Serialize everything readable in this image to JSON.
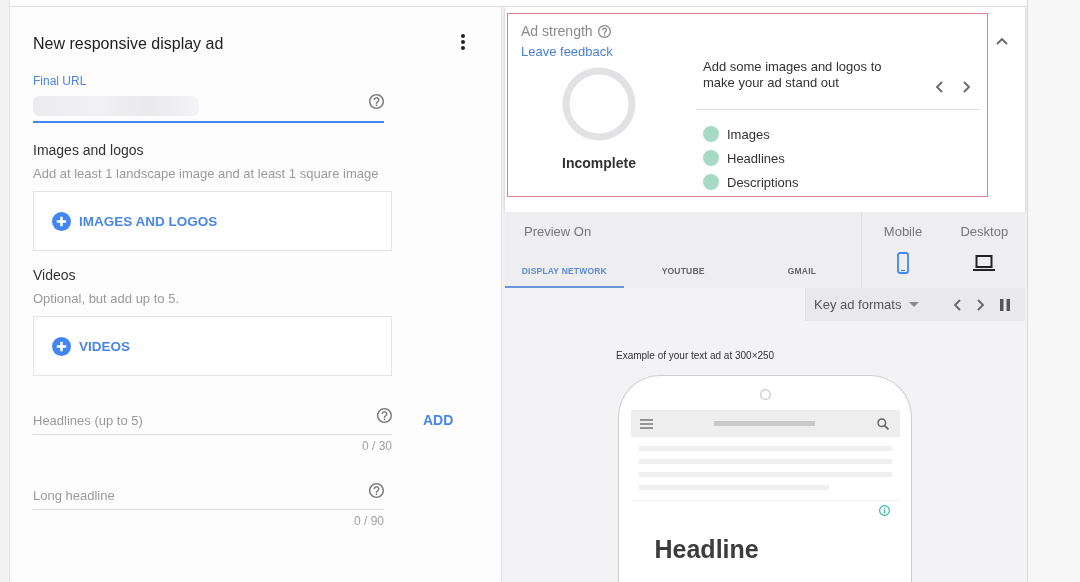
{
  "editor": {
    "title": "New responsive display ad",
    "final_url": {
      "label": "Final URL",
      "focused": true,
      "redacted": true
    },
    "sections": [
      {
        "kind": "upload",
        "title": "Images and logos",
        "hint": "Add at least 1 landscape image and at least 1 square image",
        "button": "IMAGES AND LOGOS"
      },
      {
        "kind": "upload",
        "title": "Videos",
        "hint": "Optional, but add up to 5.",
        "button": "VIDEOS"
      },
      {
        "kind": "text",
        "placeholder": "Headlines (up to 5)",
        "counter": "0 / 30",
        "add_button": "ADD"
      },
      {
        "kind": "text",
        "placeholder": "Long headline",
        "counter": "0 / 90"
      }
    ]
  },
  "ad_strength": {
    "title": "Ad strength",
    "link": "Leave feedback",
    "rating": "Incomplete",
    "tip": "Add some images and logos to make your ad stand out",
    "checklist": [
      "Images",
      "Headlines",
      "Descriptions"
    ]
  },
  "preview": {
    "title": "Preview On",
    "tabs": [
      {
        "label": "DISPLAY NETWORK",
        "selected": true
      },
      {
        "label": "YOUTUBE",
        "selected": false
      },
      {
        "label": "GMAIL",
        "selected": false
      }
    ],
    "devices": [
      {
        "kind": "mobile",
        "label": "Mobile",
        "selected": true
      },
      {
        "kind": "desktop",
        "label": "Desktop",
        "selected": false
      }
    ],
    "format_select": "Key ad formats",
    "example_caption": "Example of your text ad at 300×250",
    "ad_headline": "Headline"
  }
}
